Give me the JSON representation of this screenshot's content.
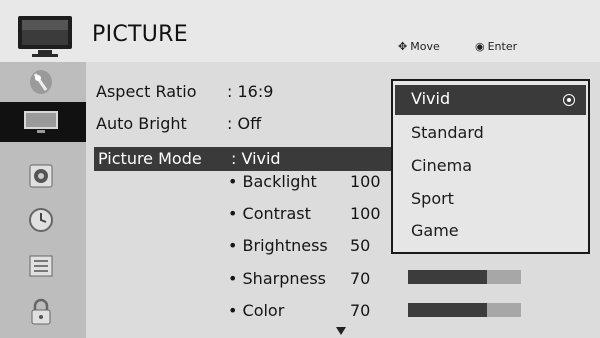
{
  "header": {
    "title": "PICTURE",
    "hint_move": "Move",
    "hint_enter": "Enter"
  },
  "sidebar": {
    "items": [
      {
        "icon": "satellite-dish-icon"
      },
      {
        "icon": "tv-screen-icon"
      },
      {
        "icon": "speaker-icon"
      },
      {
        "icon": "clock-icon"
      },
      {
        "icon": "grid-option-icon"
      },
      {
        "icon": "lock-icon"
      }
    ],
    "active_index": 1
  },
  "settings": {
    "aspect_ratio": {
      "label": "Aspect Ratio",
      "value": ": 16:9"
    },
    "auto_bright": {
      "label": "Auto Bright",
      "value": ": Off"
    },
    "picture_mode": {
      "label": "Picture Mode",
      "value": ": Vivid"
    }
  },
  "sub_settings": [
    {
      "label": "• Backlight",
      "value": "100",
      "level": 1.0
    },
    {
      "label": "• Contrast",
      "value": "100",
      "level": 1.0
    },
    {
      "label": "• Brightness",
      "value": "50",
      "level": 0.5
    },
    {
      "label": "• Sharpness",
      "value": "70",
      "level": 0.7
    },
    {
      "label": "• Color",
      "value": "70",
      "level": 0.7
    }
  ],
  "picture_mode_dropdown": {
    "options": [
      "Vivid",
      "Standard",
      "Cinema",
      "Sport",
      "Game"
    ],
    "selected": "Vivid"
  },
  "colors": {
    "highlight": "#3a3a3a",
    "bar_fill": "#3c3c3c",
    "bar_track": "#a7a7a7"
  }
}
